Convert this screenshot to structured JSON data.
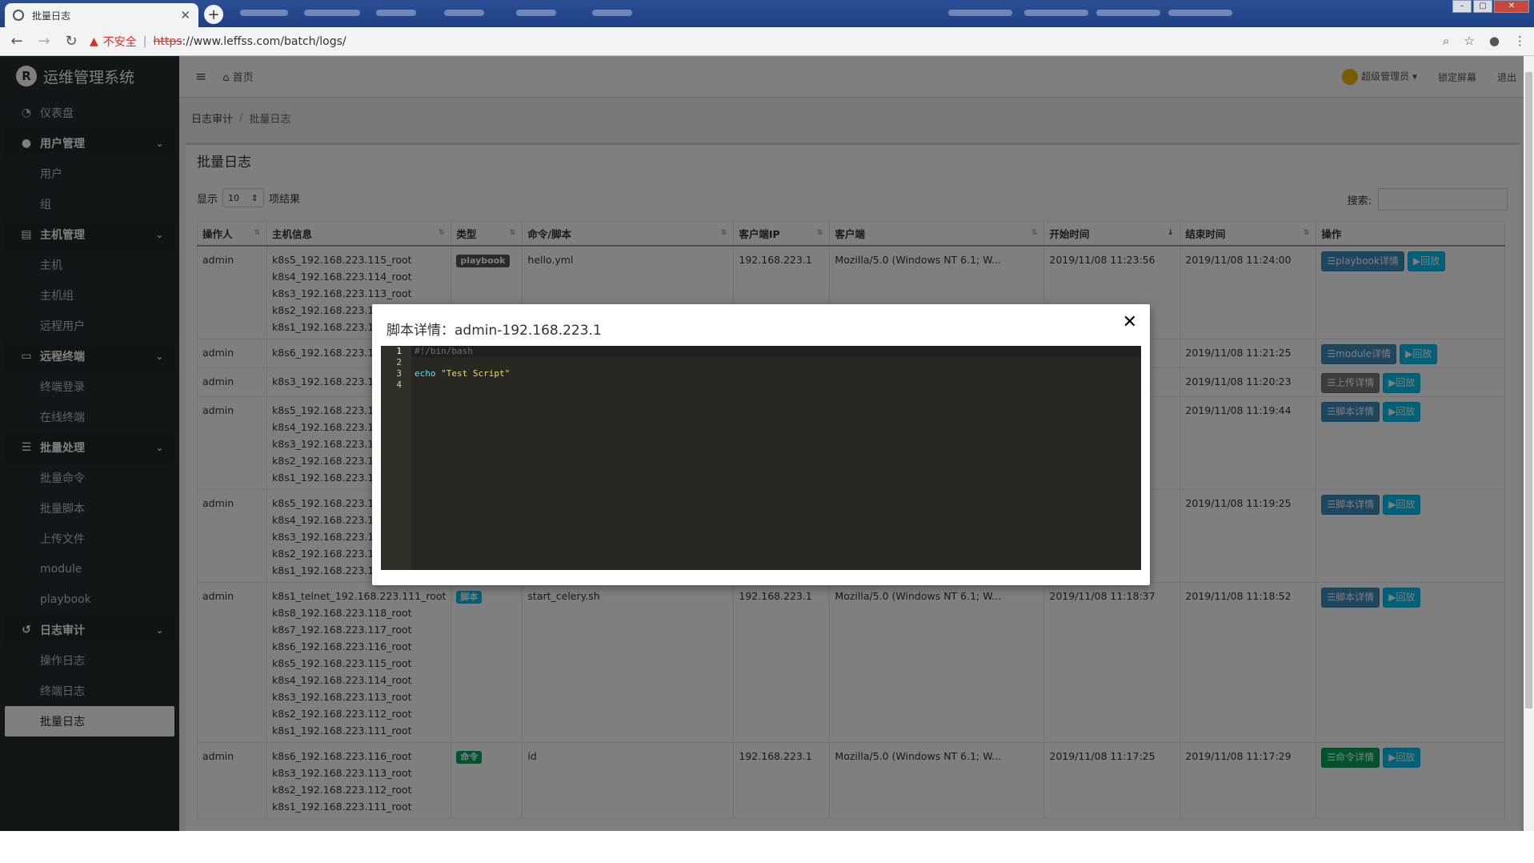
{
  "browser": {
    "tab_title": "批量日志",
    "insecure_label": "不安全",
    "url_scheme": "https",
    "url_rest": "://www.leffss.com/batch/logs/"
  },
  "sidebar": {
    "brand": "运维管理系统",
    "brand_logo": "R",
    "items": [
      {
        "label": "仪表盘",
        "icon": "dashboard-icon"
      },
      {
        "label": "用户管理",
        "icon": "user-icon",
        "group": true,
        "children": [
          "用户",
          "组"
        ]
      },
      {
        "label": "主机管理",
        "icon": "server-icon",
        "group": true,
        "children": [
          "主机",
          "主机组",
          "远程用户"
        ]
      },
      {
        "label": "远程终端",
        "icon": "laptop-icon",
        "group": true,
        "children": [
          "终端登录",
          "在线终端"
        ]
      },
      {
        "label": "批量处理",
        "icon": "list-icon",
        "group": true,
        "children": [
          "批量命令",
          "批量脚本",
          "上传文件",
          "module",
          "playbook"
        ]
      },
      {
        "label": "日志审计",
        "icon": "history-icon",
        "group": true,
        "children": [
          "操作日志",
          "终端日志",
          "批量日志"
        ]
      }
    ]
  },
  "topbar": {
    "home": "首页",
    "user": "超级管理员",
    "lock": "锁定屏幕",
    "logout": "退出"
  },
  "breadcrumb": {
    "parent": "日志审计",
    "current": "批量日志"
  },
  "box": {
    "title": "批量日志",
    "show_label": "显示",
    "page_size": "10",
    "results_label": "项结果",
    "search_label": "搜索:"
  },
  "table": {
    "headers": [
      "操作人",
      "主机信息",
      "类型",
      "命令/脚本",
      "客户端IP",
      "客户端",
      "开始时间",
      "结束时间",
      "操作"
    ],
    "rows": [
      {
        "user": "admin",
        "hosts": [
          "k8s5_192.168.223.115_root",
          "k8s4_192.168.223.114_root",
          "k8s3_192.168.223.113_root",
          "k8s2_192.168.223.112_root",
          "k8s1_192.168.223.111_root"
        ],
        "type": "playbook",
        "type_color": "#555555",
        "cmd": "hello.yml",
        "ip": "192.168.223.1",
        "client": "Mozilla/5.0 (Windows NT 6.1; W...",
        "start": "2019/11/08 11:23:56",
        "end": "2019/11/08 11:24:00",
        "detail": "playbook详情",
        "detail_style": "btn-primary",
        "replay": "回放"
      },
      {
        "user": "admin",
        "hosts": [
          "k8s6_192.168.223.116_root"
        ],
        "type": "",
        "cmd": "",
        "ip": "",
        "client": "",
        "start": "",
        "end": "2019/11/08 11:21:25",
        "detail": "module详情",
        "detail_style": "btn-primary",
        "replay": "回放"
      },
      {
        "user": "admin",
        "hosts": [
          "k8s3_192.168.223.113_root"
        ],
        "type": "",
        "cmd": "",
        "ip": "",
        "client": "",
        "start": "",
        "end": "2019/11/08 11:20:23",
        "detail": "上传详情",
        "detail_style": "btn-default",
        "replay": "回放"
      },
      {
        "user": "admin",
        "hosts": [
          "k8s5_192.168.223.115_root",
          "k8s4_192.168.223.114_root",
          "k8s3_192.168.223.113_root",
          "k8s2_192.168.223.112_root",
          "k8s1_192.168.223.111_root"
        ],
        "type": "",
        "cmd": "",
        "ip": "",
        "client": "",
        "start": "",
        "end": "2019/11/08 11:19:44",
        "detail": "脚本详情",
        "detail_style": "btn-primary",
        "replay": "回放"
      },
      {
        "user": "admin",
        "hosts": [
          "k8s5_192.168.223.115_root",
          "k8s4_192.168.223.114_root",
          "k8s3_192.168.223.113_root",
          "k8s2_192.168.223.112_root",
          "k8s1_192.168.223.111_root"
        ],
        "type": "",
        "cmd": "",
        "ip": "",
        "client": "",
        "start": "",
        "end": "2019/11/08 11:19:25",
        "detail": "脚本详情",
        "detail_style": "btn-primary",
        "replay": "回放"
      },
      {
        "user": "admin",
        "hosts": [
          "k8s1_telnet_192.168.223.111_root",
          "k8s8_192.168.223.118_root",
          "k8s7_192.168.223.117_root",
          "k8s6_192.168.223.116_root",
          "k8s5_192.168.223.115_root",
          "k8s4_192.168.223.114_root",
          "k8s3_192.168.223.113_root",
          "k8s2_192.168.223.112_root",
          "k8s1_192.168.223.111_root"
        ],
        "type": "脚本",
        "type_color": "#00c0ef",
        "cmd": "start_celery.sh",
        "ip": "192.168.223.1",
        "client": "Mozilla/5.0 (Windows NT 6.1; W...",
        "start": "2019/11/08 11:18:37",
        "end": "2019/11/08 11:18:52",
        "detail": "脚本详情",
        "detail_style": "btn-primary",
        "replay": "回放"
      },
      {
        "user": "admin",
        "hosts": [
          "k8s6_192.168.223.116_root",
          "k8s3_192.168.223.113_root",
          "k8s2_192.168.223.112_root",
          "k8s1_192.168.223.111_root"
        ],
        "type": "命令",
        "type_color": "#00a65a",
        "cmd": "id",
        "ip": "192.168.223.1",
        "client": "Mozilla/5.0 (Windows NT 6.1; W...",
        "start": "2019/11/08 11:17:25",
        "end": "2019/11/08 11:17:29",
        "detail": "命令详情",
        "detail_style": "btn-success",
        "replay": "回放"
      }
    ]
  },
  "modal": {
    "title": "脚本详情：admin-192.168.223.1",
    "lines": [
      {
        "n": "1",
        "text": "#!/bin/bash"
      },
      {
        "n": "2",
        "text": ""
      },
      {
        "n": "3",
        "kw": "echo",
        "str": "\"Test Script\""
      },
      {
        "n": "4",
        "text": ""
      }
    ]
  }
}
